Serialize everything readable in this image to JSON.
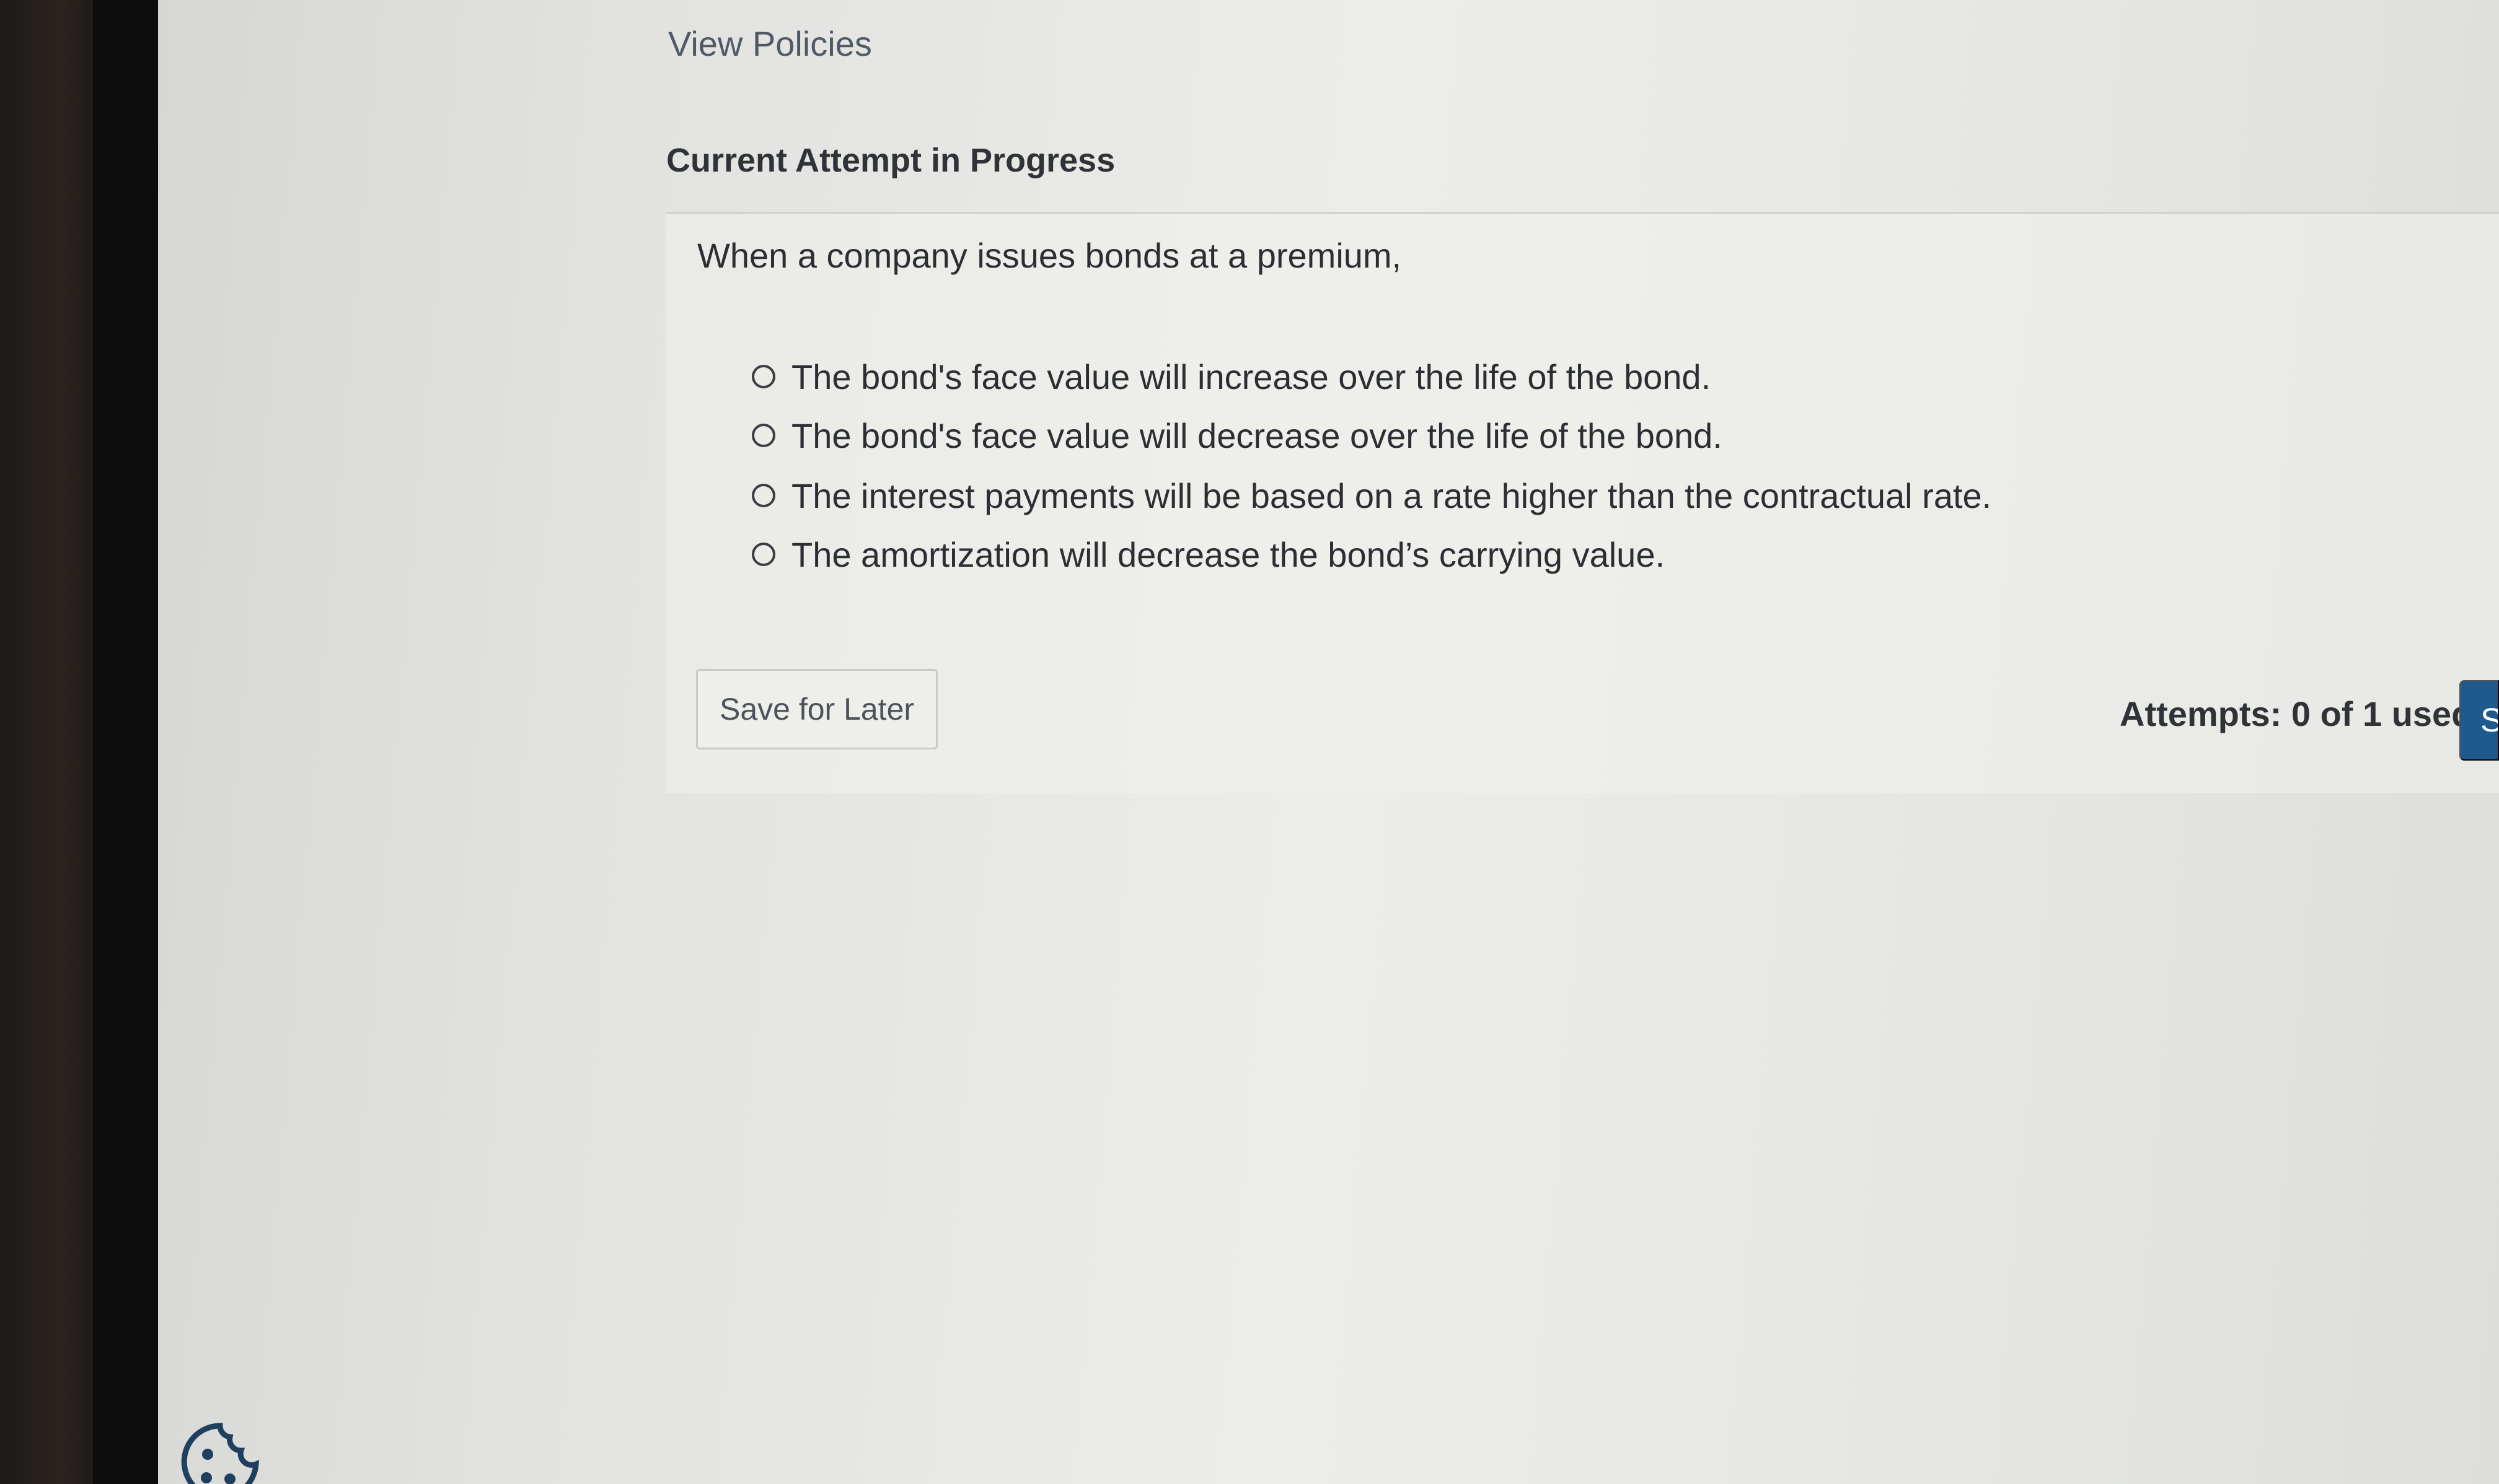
{
  "header": {
    "view_policies_link": "View Policies",
    "attempt_heading": "Current Attempt in Progress"
  },
  "question": {
    "prompt": "When a company issues bonds at a premium,",
    "options": [
      {
        "label": "The bond's face value will increase over the life of the bond.",
        "selected": false
      },
      {
        "label": "The bond's face value will decrease over the life of the bond.",
        "selected": false
      },
      {
        "label": "The interest payments will be based on a rate higher than the contractual rate.",
        "selected": false
      },
      {
        "label": "The amortization will decrease the bond’s carrying value.",
        "selected": false
      }
    ]
  },
  "footer": {
    "save_label": "Save for Later",
    "attempts_text": "Attempts: 0 of 1 used",
    "submit_label_visible": "S"
  },
  "icons": {
    "cookie": "cookie-icon"
  },
  "colors": {
    "submit_button": "#1f5a8e",
    "link_text": "#505a66"
  }
}
